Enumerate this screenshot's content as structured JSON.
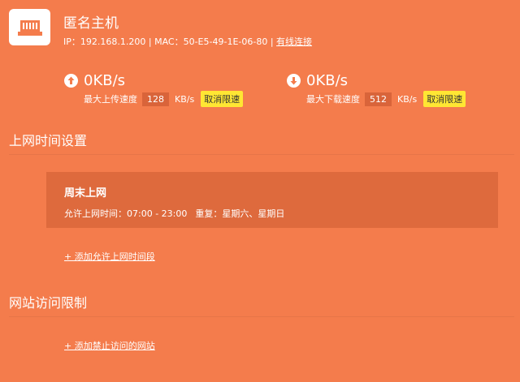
{
  "device": {
    "name": "匿名主机",
    "ip_label": "IP：",
    "ip": "192.168.1.200",
    "mac_label": "MAC：",
    "mac": "50-E5-49-1E-06-80",
    "separator": " | ",
    "connection": "有线连接"
  },
  "upload": {
    "value": "0KB/s",
    "label": "最大上传速度",
    "limit": "128",
    "unit": "KB/s",
    "cancel_label": "取消限速"
  },
  "download": {
    "value": "0KB/s",
    "label": "最大下载速度",
    "limit": "512",
    "unit": "KB/s",
    "cancel_label": "取消限速"
  },
  "time_section": {
    "title": "上网时间设置",
    "schedule": {
      "name": "周末上网",
      "allowed_label": "允许上网时间：",
      "allowed_time": "07:00 - 23:00",
      "repeat_label": "重复：",
      "repeat_days": "星期六、星期日"
    },
    "add_label": "+ 添加允许上网时间段"
  },
  "site_section": {
    "title": "网站访问限制",
    "add_label": "+ 添加禁止访问的网站"
  },
  "colors": {
    "background": "#F47C4C",
    "card": "#DE6A3D",
    "limit_box": "#D9643A",
    "cancel_button": "#FFE633"
  }
}
